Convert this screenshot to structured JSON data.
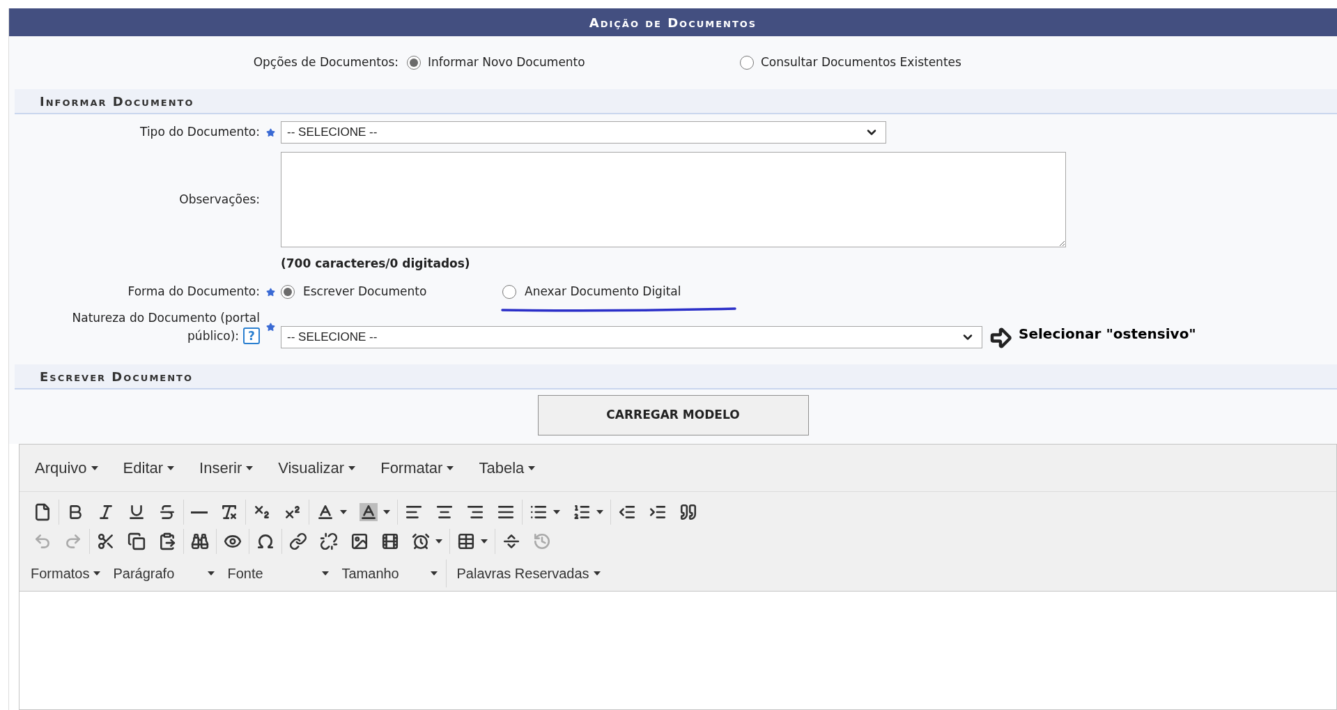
{
  "title": "Adição de Documentos",
  "document_options": {
    "label": "Opções de Documentos:",
    "options": [
      {
        "label": "Informar Novo Documento",
        "selected": true
      },
      {
        "label": "Consultar Documentos Existentes",
        "selected": false
      }
    ]
  },
  "section_inform": {
    "title": "Informar Documento"
  },
  "tipo": {
    "label": "Tipo do Documento:",
    "required": true,
    "value": "-- SELECIONE --"
  },
  "observacoes": {
    "label": "Observações:",
    "counter": "(700 caracteres/0 digitados)"
  },
  "forma": {
    "label": "Forma do Documento:",
    "required": true,
    "options": [
      {
        "label": "Escrever Documento",
        "selected": true,
        "highlighted": false
      },
      {
        "label": "Anexar Documento Digital",
        "selected": false,
        "highlighted": true
      }
    ]
  },
  "natureza": {
    "label_line1": "Natureza do Documento (portal",
    "label_line2": "público):",
    "help": "?",
    "required": true,
    "value": "-- SELECIONE --",
    "annotation": "Selecionar \"ostensivo\""
  },
  "section_write": {
    "title": "Escrever Documento"
  },
  "load_button": "CARREGAR MODELO",
  "editor": {
    "menus": [
      "Arquivo",
      "Editar",
      "Inserir",
      "Visualizar",
      "Formatar",
      "Tabela"
    ],
    "toolbar": [
      [
        [
          {
            "kind": "new-document",
            "disabled": false
          }
        ],
        [
          {
            "kind": "bold",
            "disabled": false
          },
          {
            "kind": "italic",
            "disabled": false
          },
          {
            "kind": "underline",
            "disabled": false
          },
          {
            "kind": "strikethrough",
            "disabled": false
          }
        ],
        [
          {
            "kind": "horizontal-rule",
            "disabled": false
          },
          {
            "kind": "clear-format",
            "disabled": false
          }
        ],
        [
          {
            "kind": "subscript",
            "disabled": false
          },
          {
            "kind": "superscript",
            "disabled": false
          }
        ],
        [
          {
            "kind": "text-color",
            "disabled": false
          },
          {
            "kind": "background-color",
            "disabled": false
          }
        ],
        [
          {
            "kind": "align-left",
            "disabled": false
          },
          {
            "kind": "align-center",
            "disabled": false
          },
          {
            "kind": "align-right",
            "disabled": false
          },
          {
            "kind": "align-justify",
            "disabled": false
          }
        ],
        [
          {
            "kind": "bullet-list",
            "disabled": false
          },
          {
            "kind": "numbered-list",
            "disabled": false
          }
        ],
        [
          {
            "kind": "outdent",
            "disabled": false
          },
          {
            "kind": "indent",
            "disabled": false
          },
          {
            "kind": "blockquote",
            "disabled": false
          }
        ]
      ],
      [
        [
          {
            "kind": "undo",
            "disabled": true
          },
          {
            "kind": "redo",
            "disabled": true
          }
        ],
        [
          {
            "kind": "cut",
            "disabled": false
          },
          {
            "kind": "copy",
            "disabled": false
          },
          {
            "kind": "paste",
            "disabled": false
          }
        ],
        [
          {
            "kind": "find",
            "disabled": false
          }
        ],
        [
          {
            "kind": "preview",
            "disabled": false
          }
        ],
        [
          {
            "kind": "special-char",
            "disabled": false
          }
        ],
        [
          {
            "kind": "link",
            "disabled": false
          },
          {
            "kind": "unlink",
            "disabled": false
          },
          {
            "kind": "image",
            "disabled": false
          },
          {
            "kind": "media",
            "disabled": false
          },
          {
            "kind": "time",
            "disabled": false
          }
        ],
        [
          {
            "kind": "table",
            "disabled": false
          }
        ],
        [
          {
            "kind": "page-break",
            "disabled": false
          },
          {
            "kind": "restore-draft",
            "disabled": true
          }
        ]
      ]
    ],
    "selects": [
      {
        "label": "Formatos",
        "kind": "menu"
      },
      {
        "label": "Parágrafo",
        "kind": "list"
      },
      {
        "label": "Fonte",
        "kind": "list"
      },
      {
        "label": "Tamanho",
        "kind": "list"
      },
      {
        "label": "Palavras Reservadas",
        "kind": "menu"
      }
    ]
  }
}
